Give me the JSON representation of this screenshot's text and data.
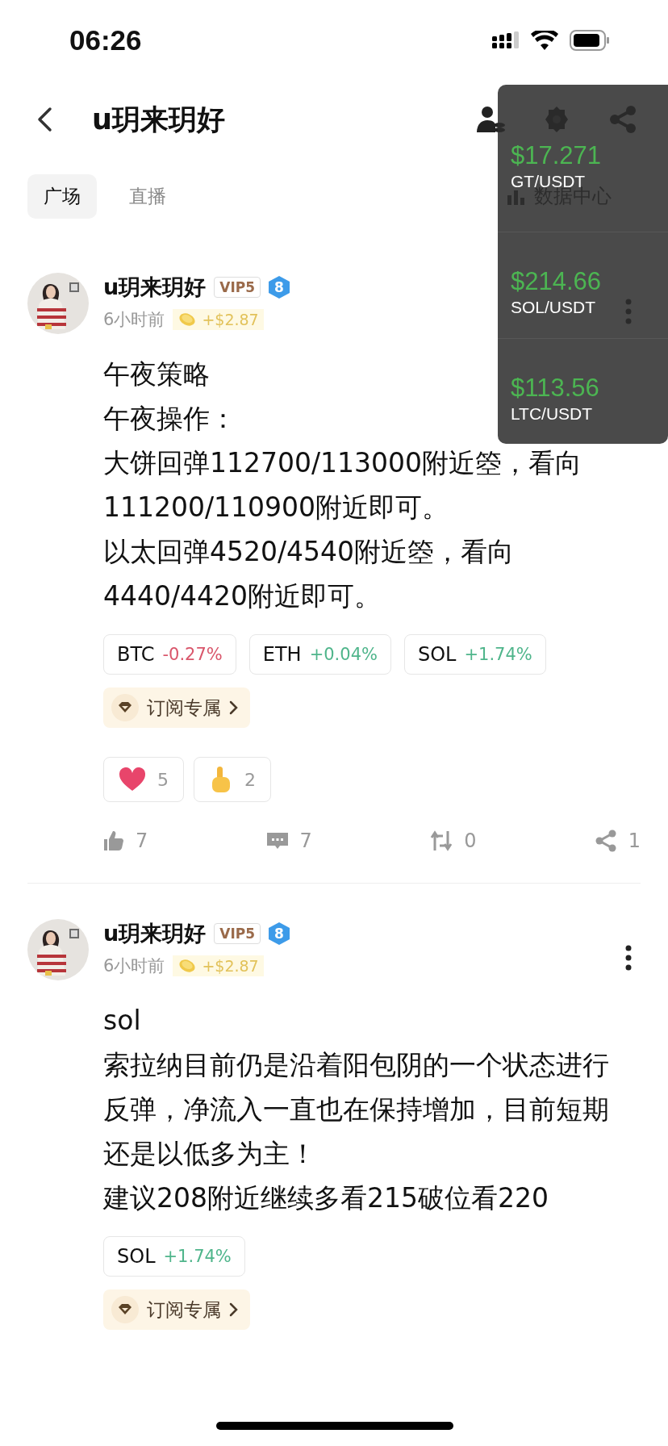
{
  "status_bar": {
    "time": "06:26"
  },
  "header": {
    "title": "u玥来玥好"
  },
  "tabs": [
    {
      "label": "广场",
      "selected": true
    },
    {
      "label": "直播",
      "selected": false
    }
  ],
  "data_center": {
    "label": "数据中心"
  },
  "posts": [
    {
      "author": "u玥来玥好",
      "vip": "VIP5",
      "level": "8",
      "time": "6小时前",
      "reward": "+$2.87",
      "paragraphs": [
        "午夜策略",
        "午夜操作：",
        "大饼回弹112700/113000附近箜，看向111200/110900附近即可。",
        "以太回弹4520/4540附近箜，看向4440/4420附近即可。"
      ],
      "tickers": [
        {
          "symbol": "BTC",
          "change": "-0.27%",
          "color": "#d9566b"
        },
        {
          "symbol": "ETH",
          "change": "+0.04%",
          "color": "#4fb58b"
        },
        {
          "symbol": "SOL",
          "change": "+1.74%",
          "color": "#4fb58b"
        }
      ],
      "subscribe": "订阅专属",
      "reactions": [
        {
          "kind": "heart",
          "count": "5"
        },
        {
          "kind": "thumb",
          "count": "2"
        }
      ],
      "actions": [
        {
          "kind": "like",
          "count": "7"
        },
        {
          "kind": "comment",
          "count": "7"
        },
        {
          "kind": "repost",
          "count": "0"
        },
        {
          "kind": "share",
          "count": "1"
        }
      ]
    },
    {
      "author": "u玥来玥好",
      "vip": "VIP5",
      "level": "8",
      "time": "6小时前",
      "reward": "+$2.87",
      "paragraphs": [
        "sol",
        "索拉纳目前仍是沿着阳包阴的一个状态进行反弹，净流入一直也在保持增加，目前短期还是以低多为主！",
        "建议208附近继续多看215破位看220"
      ],
      "tickers": [
        {
          "symbol": "SOL",
          "change": "+1.74%",
          "color": "#4fb58b"
        }
      ],
      "subscribe": "订阅专属"
    }
  ],
  "price_overlay": [
    {
      "price": "$17.271",
      "pair": "GT/USDT"
    },
    {
      "price": "$214.66",
      "pair": "SOL/USDT"
    },
    {
      "price": "$113.56",
      "pair": "LTC/USDT"
    }
  ]
}
